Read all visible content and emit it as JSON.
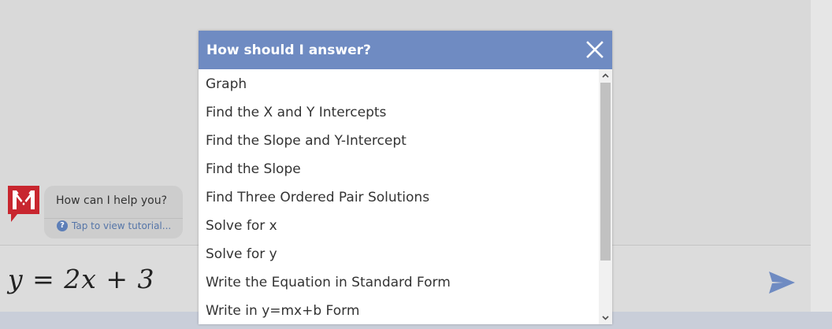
{
  "chat": {
    "greeting": "How can I help you?",
    "tutorial_link": "Tap to view tutorial...",
    "help_icon_glyph": "?"
  },
  "input": {
    "equation": "y = 2x + 3"
  },
  "dialog": {
    "title": "How should I answer?",
    "options": [
      "Graph",
      "Find the X and Y Intercepts",
      "Find the Slope and Y-Intercept",
      "Find the Slope",
      "Find Three Ordered Pair Solutions",
      "Solve for x",
      "Solve for y",
      "Write the Equation in Standard Form",
      "Write in y=mx+b Form"
    ]
  },
  "colors": {
    "header": "#6f8bc2",
    "logo_red": "#c8262f",
    "send_arrow": "#6f8bc2"
  },
  "icons": [
    "mathway-logo-icon",
    "help-circle-icon",
    "close-icon",
    "send-arrow-icon",
    "chevron-up-icon",
    "chevron-down-icon"
  ]
}
